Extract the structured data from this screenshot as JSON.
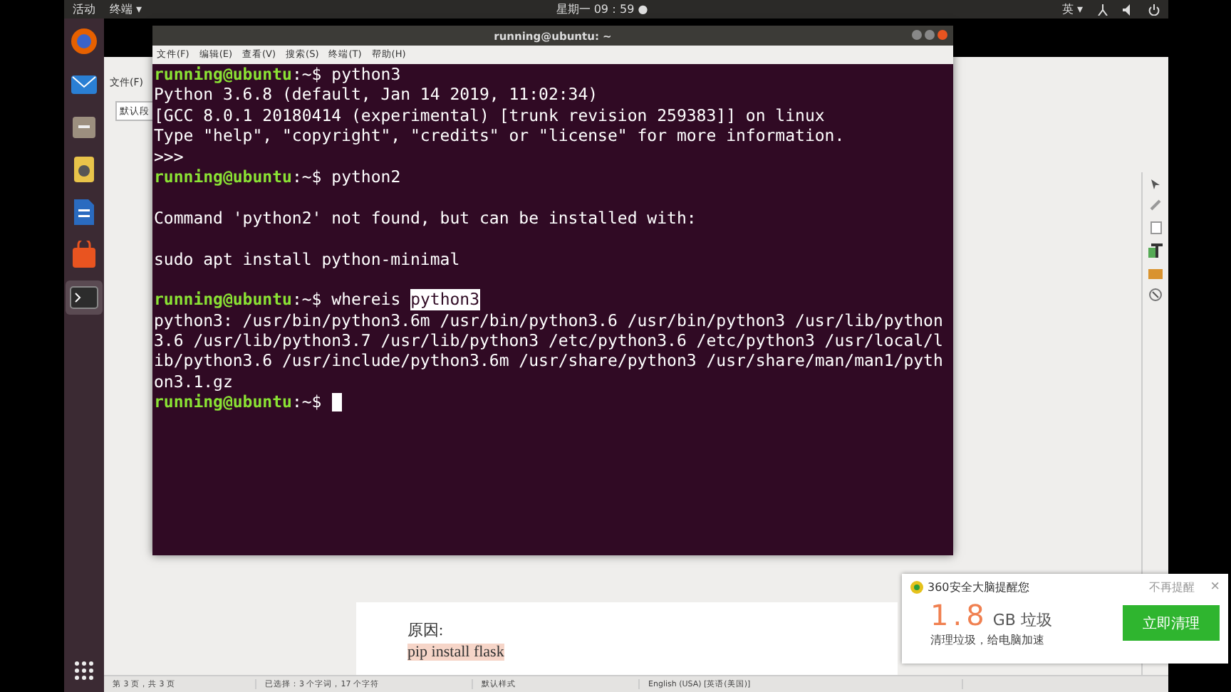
{
  "top_bar": {
    "activities": "活动",
    "app_menu": "终端 ▾",
    "clock": "星期一 09：59 ●",
    "input_method": "英 ▾"
  },
  "dock": {
    "items": [
      {
        "kind": "browser",
        "selected": false
      },
      {
        "kind": "mail",
        "selected": false
      },
      {
        "kind": "files",
        "selected": false
      },
      {
        "kind": "music",
        "selected": false
      },
      {
        "kind": "writer",
        "selected": false
      },
      {
        "kind": "store",
        "selected": false
      },
      {
        "kind": "terminal",
        "selected": true
      }
    ]
  },
  "writer": {
    "menu": [
      "文件(F)"
    ],
    "style_box": "默认段",
    "page_lines": [
      {
        "text": "原因:",
        "highlighted": false
      },
      {
        "text": "pip install flask",
        "highlighted": true
      }
    ],
    "status_bar": [
      "第 3 页，共 3 页",
      "已选择：3 个字词，17 个字符",
      "默认样式",
      "English (USA) [英语(美国)]"
    ]
  },
  "terminal": {
    "title": "running@ubuntu: ~",
    "menu": [
      "文件(F)",
      "编辑(E)",
      "查看(V)",
      "搜索(S)",
      "终端(T)",
      "帮助(H)"
    ],
    "lines": [
      {
        "kind": "prompt",
        "user": "running@ubuntu",
        "path": ":~$",
        "command": [
          {
            "text": "python3",
            "selected": false
          }
        ]
      },
      {
        "kind": "output",
        "text": "Python 3.6.8 (default, Jan 14 2019, 11:02:34)"
      },
      {
        "kind": "output",
        "text": "[GCC 8.0.1 20180414 (experimental) [trunk revision 259383]] on linux"
      },
      {
        "kind": "output",
        "text": "Type \"help\", \"copyright\", \"credits\" or \"license\" for more information."
      },
      {
        "kind": "output",
        "text": ">>>"
      },
      {
        "kind": "prompt",
        "user": "running@ubuntu",
        "path": ":~$",
        "command": [
          {
            "text": "python2",
            "selected": false
          }
        ]
      },
      {
        "kind": "blank"
      },
      {
        "kind": "output",
        "text": "Command 'python2' not found, but can be installed with:"
      },
      {
        "kind": "blank"
      },
      {
        "kind": "output",
        "text": "sudo apt install python-minimal"
      },
      {
        "kind": "blank"
      },
      {
        "kind": "prompt",
        "user": "running@ubuntu",
        "path": ":~$",
        "command": [
          {
            "text": "whereis",
            "selected": false
          },
          {
            "text": "python3",
            "selected": true
          }
        ]
      },
      {
        "kind": "output",
        "text": "python3: /usr/bin/python3.6m /usr/bin/python3.6 /usr/bin/python3 /usr/lib/python"
      },
      {
        "kind": "output",
        "text": "3.6 /usr/lib/python3.7 /usr/lib/python3 /etc/python3.6 /etc/python3 /usr/local/l"
      },
      {
        "kind": "output",
        "text": "ib/python3.6 /usr/include/python3.6m /usr/share/python3 /usr/share/man/man1/pyth"
      },
      {
        "kind": "output",
        "text": "on3.1.gz"
      },
      {
        "kind": "prompt",
        "user": "running@ubuntu",
        "path": ":~$"
      }
    ]
  },
  "notification": {
    "title": "360安全大脑提醒您",
    "dismiss": "不再提醒",
    "close": "×",
    "amount": "1.8",
    "unit": "GB 垃圾",
    "message": "清理垃圾，给电脑加速",
    "action": "立即清理"
  }
}
